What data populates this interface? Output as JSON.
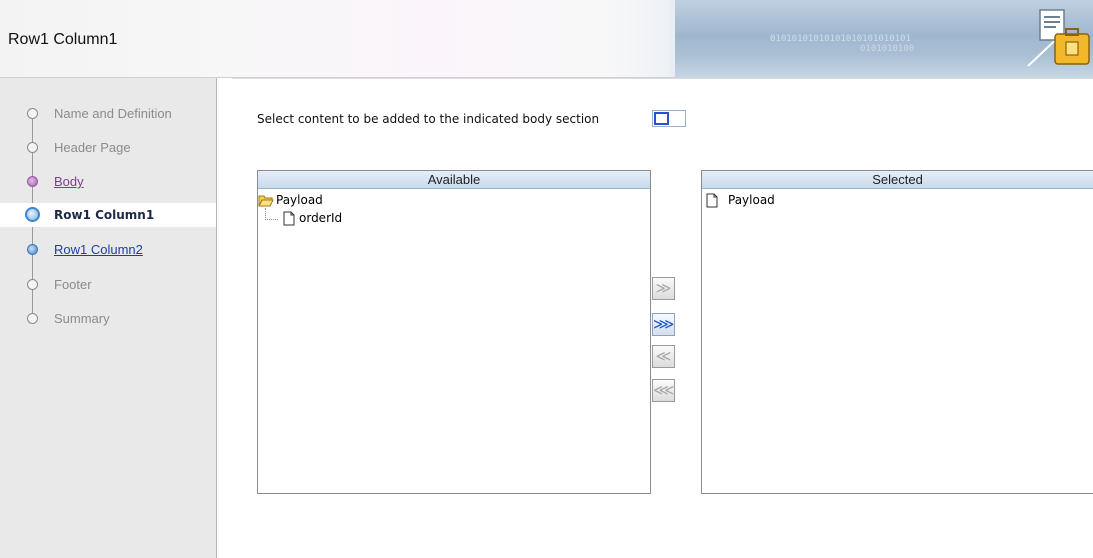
{
  "header": {
    "title": "Row1 Column1",
    "binary_line1": "01010101010101010101010101",
    "binary_line2": "0101010100"
  },
  "train": {
    "steps": [
      {
        "label": "Name and Definition",
        "state": "disabled"
      },
      {
        "label": "Header Page",
        "state": "disabled"
      },
      {
        "label": "Body",
        "state": "visited"
      },
      {
        "label": "Row1 Column1",
        "state": "current"
      },
      {
        "label": "Row1 Column2",
        "state": "link"
      },
      {
        "label": "Footer",
        "state": "disabled"
      },
      {
        "label": "Summary",
        "state": "disabled"
      }
    ]
  },
  "main": {
    "instruction": "Select content to be added to the indicated body section",
    "available": {
      "header": "Available",
      "root": "Payload",
      "child": "orderId"
    },
    "selected": {
      "header": "Selected",
      "items": [
        "Payload"
      ]
    },
    "shuttle": {
      "move": "≫",
      "move_all": "⋙",
      "remove": "≪",
      "remove_all": "⋘"
    }
  },
  "colors": {
    "accent": "#2b4fd0",
    "visited": "#7d3f8c",
    "link": "#1e3f9e",
    "panel_header": "#c8daee"
  },
  "icons": {
    "folder": "folder-open-icon",
    "document": "document-icon",
    "wizard": "briefcase-document-icon"
  }
}
